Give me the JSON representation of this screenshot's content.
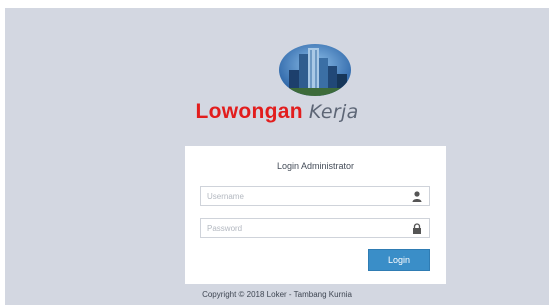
{
  "brand": {
    "name_strong": "Lowongan",
    "name_light": "Kerja"
  },
  "login": {
    "title": "Login Administrator",
    "username_placeholder": "Username",
    "password_placeholder": "Password",
    "button_label": "Login"
  },
  "footer": {
    "copyright": "Copyright © 2018 Loker - Tambang Kurnia"
  },
  "colors": {
    "background": "#d3d7e1",
    "brand_red": "#e21d1d",
    "button_blue": "#3a8ec8"
  },
  "icons": {
    "username": "user-icon",
    "password": "lock-icon"
  }
}
